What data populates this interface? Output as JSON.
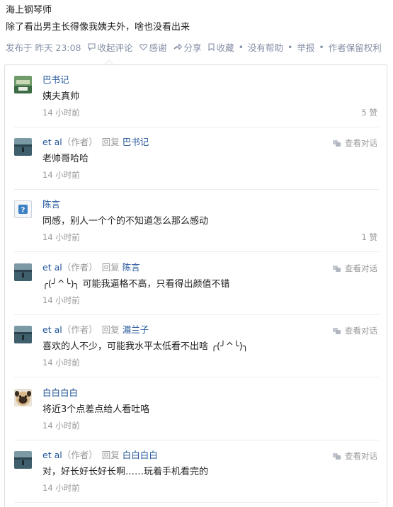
{
  "answer": {
    "author": "海上钢琴师",
    "text": "除了看出男主长得像我姨夫外，啥也没看出来"
  },
  "meta": {
    "published_prefix": "发布于",
    "published_time": "昨天 23:08",
    "collapse_label": "收起评论",
    "thanks_label": "感谢",
    "share_label": "分享",
    "favorite_label": "收藏",
    "no_help_label": "没有帮助",
    "report_label": "举报",
    "rights_label": "作者保留权利"
  },
  "labels": {
    "author_tag": "（作者）",
    "reply_word": "回复",
    "view_dialog": "查看对话"
  },
  "comments": [
    {
      "name": "巴书记",
      "text": "姨夫真帅",
      "time": "14 小时前",
      "likes": "5 赞",
      "avatar": "green-landscape"
    },
    {
      "name": "et al",
      "is_author": true,
      "reply_to": "巴书记",
      "text": "老帅哥哈哈",
      "time": "14 小时前",
      "avatar": "lake-photo"
    },
    {
      "name": "陈言",
      "text": "同感，别人一个个的不知道怎么那么感动",
      "time": "14 小时前",
      "likes": "1 赞",
      "avatar": "default-question"
    },
    {
      "name": "et al",
      "is_author": true,
      "reply_to": "陈言",
      "text": "╭(╯^╰)╮ 可能我逼格不高，只看得出颜值不错",
      "time": "14 小时前",
      "avatar": "lake-photo"
    },
    {
      "name": "et al",
      "is_author": true,
      "reply_to": "湄兰子",
      "text": "喜欢的人不少，可能我水平太低看不出啥 ╭(╯^╰)╮",
      "time": "14 小时前",
      "avatar": "lake-photo"
    },
    {
      "name": "白白白白",
      "text": "将近3个点差点给人看吐咯",
      "time": "14 小时前",
      "avatar": "pug-dog"
    },
    {
      "name": "et al",
      "is_author": true,
      "reply_to": "白白白白",
      "text": "对，好长好长好长啊……玩着手机看完的",
      "time": "14 小时前",
      "avatar": "lake-photo"
    }
  ],
  "colors": {
    "link_blue": "#225599",
    "meta_gray": "#8590a6",
    "border": "#dadde3"
  }
}
